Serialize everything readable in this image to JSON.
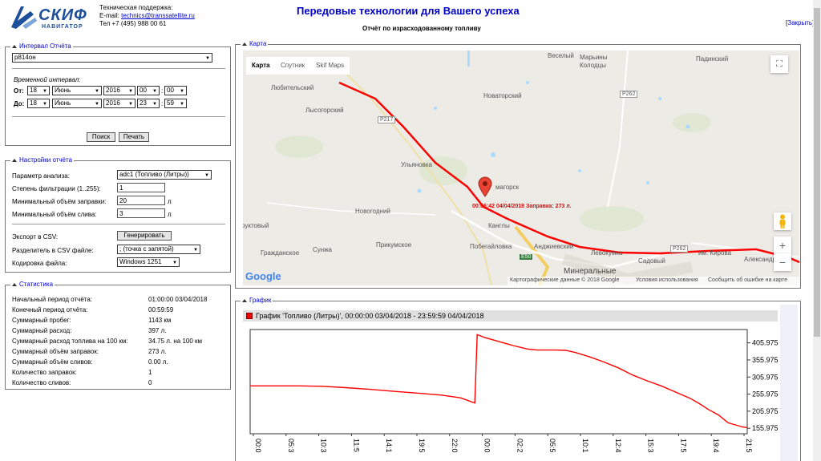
{
  "header": {
    "logo_text": "СКИФ",
    "logo_sub": "НАВИГАТОР",
    "support_title": "Техническая поддержка:",
    "email_label": "E-mail:",
    "email": "technics@transsatellite.ru",
    "phone": "Тел +7 (495) 988 00 61",
    "page_title": "Передовые технологии для Вашего успеха",
    "report_title": "Отчёт по израсходованному топливу",
    "close_open": "[",
    "close_label": "Закрыть",
    "close_close": "]"
  },
  "interval": {
    "legend": "Интервал Отчёта",
    "vehicle": "р814он",
    "time_label": "Временной интервал:",
    "from_label": "От:",
    "to_label": "До:",
    "from": {
      "day": "18",
      "month": "Июнь",
      "year": "2016",
      "hour": "00",
      "min": "00"
    },
    "to": {
      "day": "18",
      "month": "Июнь",
      "year": "2016",
      "hour": "23",
      "min": "59"
    },
    "colon": ":",
    "search_btn": "Поиск",
    "print_btn": "Печать"
  },
  "settings": {
    "legend": "Настройки отчёта",
    "param_label": "Параметр анализа:",
    "param_value": "adc1 (Топливо (Литры))",
    "filter_label": "Степень фильтрации (1..255):",
    "filter_value": "1",
    "min_refuel_label": "Минимальный объём заправки:",
    "min_refuel_value": "20",
    "min_drain_label": "Минимальный объём слива:",
    "min_drain_value": "3",
    "unit": "л",
    "csv_label": "Экспорт в CSV:",
    "csv_btn": "Генерировать",
    "sep_label": "Разделитель в CSV файле:",
    "sep_value": "; (точка с запятой)",
    "enc_label": "Кодировка файла:",
    "enc_value": "Windows 1251"
  },
  "stats": {
    "legend": "Статистика",
    "rows": [
      {
        "label": "Начальный период отчёта:",
        "value": "01:00:00 03/04/2018"
      },
      {
        "label": "Конечный период отчёта:",
        "value": "00:59:59"
      },
      {
        "label": "Суммарный пробег:",
        "value": "1143 км"
      },
      {
        "label": "Суммарный расход:",
        "value": "397 л."
      },
      {
        "label": "Суммарный расход топлива на 100 км:",
        "value": "34.75 л. на 100 км"
      },
      {
        "label": "Суммарный объём заправок:",
        "value": "273 л."
      },
      {
        "label": "Суммарный объём сливов:",
        "value": "0.00 л."
      },
      {
        "label": "Количество заправок:",
        "value": "1"
      },
      {
        "label": "Количество сливов:",
        "value": "0"
      }
    ]
  },
  "map": {
    "legend": "Карта",
    "tabs": [
      "Карта",
      "Спутник",
      "Skif Maps"
    ],
    "places": [
      "Веселый",
      "Марьины Колодцы",
      "Падинский",
      "Любительский",
      "Лысогорский",
      "Новаторский",
      "Ульяновка",
      "магорск",
      "Новогодний",
      "руктовый",
      "Канглы",
      "Прикумское",
      "Побегайловка",
      "Анджиевский",
      "Левокумка",
      "Садовый",
      "им. Кирова",
      "Александрово",
      "Гражданское",
      "Сунжа",
      "Минеральные"
    ],
    "roads": [
      "Р262",
      "Р217",
      "Р262",
      "E50"
    ],
    "marker_label": "00:06:42 04/04/2018 Заправка: 273 л.",
    "google": "Google",
    "attribution": "Картографические данные © 2018 Google",
    "terms": "Условия использования",
    "report_error": "Сообщить об ошибке на карте",
    "zoom_in": "+",
    "zoom_out": "−"
  },
  "chart_panel": {
    "legend": "График",
    "series_label": "График 'Топливо (Литры)', 00:00:00 03/04/2018 - 23:59:59 04/04/2018"
  },
  "chart_data": {
    "type": "line",
    "title": "График 'Топливо (Литры)', 00:00:00 03/04/2018 - 23:59:59 04/04/2018",
    "y_ticks": [
      405.975,
      355.975,
      305.975,
      255.975,
      205.975,
      155.975
    ],
    "ylim": [
      140,
      445
    ],
    "x_ticks": [
      "00:0",
      "05:3",
      "10:3",
      "11:5",
      "14:1",
      "19:5",
      "22:0",
      "00:0",
      "02:2",
      "05:5",
      "10:1",
      "12:4",
      "15:3",
      "17:5",
      "19:4",
      "21:5"
    ],
    "series": [
      {
        "name": "Топливо (Литры)",
        "color": "#ff0000",
        "points": [
          [
            0,
            280
          ],
          [
            5,
            280
          ],
          [
            10,
            280
          ],
          [
            15,
            279
          ],
          [
            20,
            275
          ],
          [
            25,
            270
          ],
          [
            30,
            264
          ],
          [
            35,
            259
          ],
          [
            40,
            253
          ],
          [
            44,
            245
          ],
          [
            47,
            230
          ],
          [
            47.5,
            430
          ],
          [
            49,
            422
          ],
          [
            52,
            410
          ],
          [
            55,
            398
          ],
          [
            58,
            388
          ],
          [
            60,
            385
          ],
          [
            62,
            385
          ],
          [
            64,
            385
          ],
          [
            66,
            384
          ],
          [
            68,
            378
          ],
          [
            71,
            365
          ],
          [
            74,
            350
          ],
          [
            77,
            333
          ],
          [
            80,
            312
          ],
          [
            83,
            295
          ],
          [
            86,
            280
          ],
          [
            89,
            262
          ],
          [
            92,
            244
          ],
          [
            94,
            228
          ],
          [
            96,
            210
          ],
          [
            98,
            195
          ],
          [
            100,
            172
          ],
          [
            103,
            160
          ],
          [
            104,
            158
          ]
        ]
      }
    ]
  }
}
